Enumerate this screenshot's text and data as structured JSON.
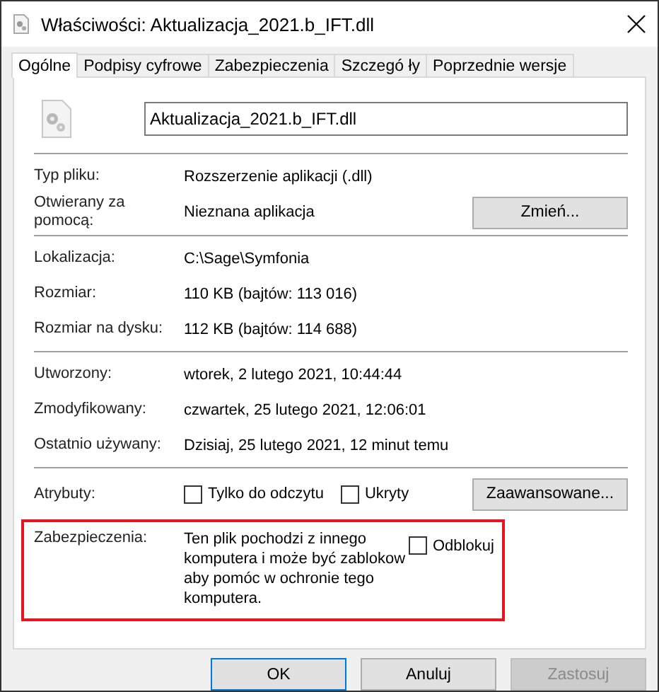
{
  "window": {
    "title": "Właściwości: Aktualizacja_2021.b_IFT.dll"
  },
  "tabs": [
    {
      "label": "Ogólne",
      "selected": true
    },
    {
      "label": "Podpisy cyfrowe",
      "selected": false
    },
    {
      "label": "Zabezpieczenia",
      "selected": false
    },
    {
      "label": "Szczegó ły",
      "selected": false
    },
    {
      "label": "Poprzednie wersje",
      "selected": false
    }
  ],
  "file_name": "Aktualizacja_2021.b_IFT.dll",
  "sections": [
    [
      {
        "label": "Typ pliku:",
        "value": "Rozszerzenie aplikacji (.dll)"
      },
      {
        "label": "Otwierany za pomocą:",
        "value": "Nieznana aplikacja",
        "button": "Zmień..."
      }
    ],
    [
      {
        "label": "Lokalizacja:",
        "value": "C:\\Sage\\Symfonia"
      },
      {
        "label": "Rozmiar:",
        "value": "110 KB (bajtów: 113 016)"
      },
      {
        "label": "Rozmiar na dysku:",
        "value": "112 KB (bajtów: 114 688)"
      }
    ],
    [
      {
        "label": "Utworzony:",
        "value": "wtorek, 2 lutego 2021, 10:44:44"
      },
      {
        "label": "Zmodyfikowany:",
        "value": "czwartek, 25 lutego 2021, 12:06:01"
      },
      {
        "label": "Ostatnio używany:",
        "value": "Dzisiaj, 25 lutego 2021, 12 minut temu"
      }
    ]
  ],
  "attributes": {
    "label": "Atrybuty:",
    "checkboxes": [
      {
        "label": "Tylko do odczytu",
        "checked": false
      },
      {
        "label": "Ukryty",
        "checked": false
      }
    ],
    "button": "Zaawansowane..."
  },
  "security": {
    "label": "Zabezpieczenia:",
    "lines": [
      "Ten plik pochodzi z innego",
      "komputera i może być zablokow",
      "aby pomóc w ochronie tego",
      "komputera."
    ],
    "checkbox": {
      "label": "Odblokuj",
      "checked": false
    },
    "highlighted": true
  },
  "buttons": [
    {
      "label": "OK",
      "default": true,
      "disabled": false
    },
    {
      "label": "Anuluj",
      "default": false,
      "disabled": false
    },
    {
      "label": "Zastosuj",
      "default": false,
      "disabled": true
    }
  ]
}
